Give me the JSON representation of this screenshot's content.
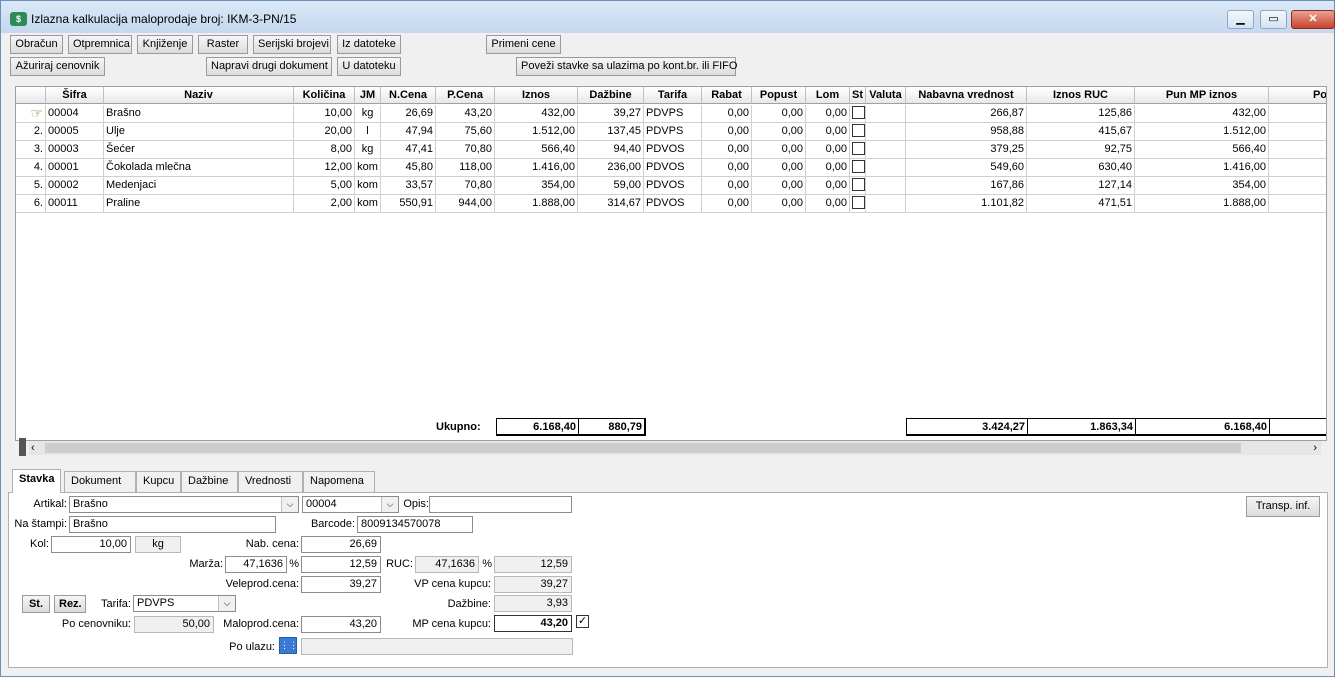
{
  "window": {
    "title": "Izlazna kalkulacija maloprodaje broj: IKM-3-PN/15",
    "app_icon": "calculation-app-icon",
    "controls": {
      "minimize": "▁",
      "maximize": "▭",
      "close": "✕"
    }
  },
  "toolbar": {
    "row1": [
      "Obračun",
      "Otpremnica",
      "Knjiženje",
      "Raster",
      "Serijski brojevi",
      "Iz datoteke",
      "Primeni cene"
    ],
    "row2": [
      "Ažuriraj cenovnik",
      "Napravi drugi dokument",
      "U datoteku",
      "Poveži stavke sa ulazima po kont.br. ili FIFO"
    ]
  },
  "grid": {
    "columns": [
      "Šifra",
      "Naziv",
      "Količina",
      "JM",
      "N.Cena",
      "P.Cena",
      "Iznos",
      "Dažbine",
      "Tarifa",
      "Rabat",
      "Popust",
      "Lom",
      "St",
      "Valuta",
      "Nabavna vrednost",
      "Iznos RUC",
      "Pun MP iznos",
      "Po"
    ],
    "rows": [
      {
        "rb": "",
        "sifra": "00004",
        "naziv": "Brašno",
        "kolicina": "10,00",
        "jm": "kg",
        "ncena": "26,69",
        "pcena": "43,20",
        "iznos": "432,00",
        "dazbine": "39,27",
        "tarifa": "PDVPS",
        "rabat": "0,00",
        "popust": "0,00",
        "lom": "0,00",
        "nabavna": "266,87",
        "ruc": "125,86",
        "punmp": "432,00"
      },
      {
        "rb": "2.",
        "sifra": "00005",
        "naziv": "Ulje",
        "kolicina": "20,00",
        "jm": "l",
        "ncena": "47,94",
        "pcena": "75,60",
        "iznos": "1.512,00",
        "dazbine": "137,45",
        "tarifa": "PDVPS",
        "rabat": "0,00",
        "popust": "0,00",
        "lom": "0,00",
        "nabavna": "958,88",
        "ruc": "415,67",
        "punmp": "1.512,00"
      },
      {
        "rb": "3.",
        "sifra": "00003",
        "naziv": "Šećer",
        "kolicina": "8,00",
        "jm": "kg",
        "ncena": "47,41",
        "pcena": "70,80",
        "iznos": "566,40",
        "dazbine": "94,40",
        "tarifa": "PDVOS",
        "rabat": "0,00",
        "popust": "0,00",
        "lom": "0,00",
        "nabavna": "379,25",
        "ruc": "92,75",
        "punmp": "566,40"
      },
      {
        "rb": "4.",
        "sifra": "00001",
        "naziv": "Čokolada mlečna",
        "kolicina": "12,00",
        "jm": "kom",
        "ncena": "45,80",
        "pcena": "118,00",
        "iznos": "1.416,00",
        "dazbine": "236,00",
        "tarifa": "PDVOS",
        "rabat": "0,00",
        "popust": "0,00",
        "lom": "0,00",
        "nabavna": "549,60",
        "ruc": "630,40",
        "punmp": "1.416,00"
      },
      {
        "rb": "5.",
        "sifra": "00002",
        "naziv": "Medenjaci",
        "kolicina": "5,00",
        "jm": "kom",
        "ncena": "33,57",
        "pcena": "70,80",
        "iznos": "354,00",
        "dazbine": "59,00",
        "tarifa": "PDVOS",
        "rabat": "0,00",
        "popust": "0,00",
        "lom": "0,00",
        "nabavna": "167,86",
        "ruc": "127,14",
        "punmp": "354,00"
      },
      {
        "rb": "6.",
        "sifra": "00011",
        "naziv": "Praline",
        "kolicina": "2,00",
        "jm": "kom",
        "ncena": "550,91",
        "pcena": "944,00",
        "iznos": "1.888,00",
        "dazbine": "314,67",
        "tarifa": "PDVOS",
        "rabat": "0,00",
        "popust": "0,00",
        "lom": "0,00",
        "nabavna": "1.101,82",
        "ruc": "471,51",
        "punmp": "1.888,00"
      }
    ],
    "totals": {
      "label": "Ukupno:",
      "iznos": "6.168,40",
      "dazbine": "880,79",
      "nabavna": "3.424,27",
      "ruc": "1.863,34",
      "punmp": "6.168,40"
    }
  },
  "tabs": [
    "Stavka",
    "Dokument",
    "Kupcu",
    "Dažbine",
    "Vrednosti",
    "Napomena"
  ],
  "form": {
    "artikal_label": "Artikal:",
    "artikal": "Brašno",
    "sifra": "00004",
    "opis_label": "Opis:",
    "opis": "",
    "transp_btn": "Transp. inf.",
    "na_stampi_label": "Na štampi:",
    "na_stampi": "Brašno",
    "barcode_label": "Barcode:",
    "barcode": "8009134570078",
    "kol_label": "Kol:",
    "kol": "10,00",
    "jm": "kg",
    "nab_cena_label": "Nab. cena:",
    "nab_cena": "26,69",
    "marza_label": "Marža:",
    "marza_pct": "47,1636",
    "pct": "%",
    "marza": "12,59",
    "ruc_label": "RUC:",
    "ruc_pct": "47,1636",
    "ruc": "12,59",
    "vp_label": "Veleprod.cena:",
    "vp": "39,27",
    "vp_kupcu_label": "VP cena kupcu:",
    "vp_kupcu": "39,27",
    "st_btn": "St.",
    "rez_btn": "Rez.",
    "tarifa_label": "Tarifa:",
    "tarifa": "PDVPS",
    "dazbine_label": "Dažbine:",
    "dazbine": "3,93",
    "po_cenovniku_label": "Po cenovniku:",
    "po_cenovniku": "50,00",
    "mp_label": "Maloprod.cena:",
    "mp": "43,20",
    "mp_kupcu_label": "MP cena kupcu:",
    "mp_kupcu": "43,20",
    "po_ulazu_label": "Po ulazu:"
  }
}
